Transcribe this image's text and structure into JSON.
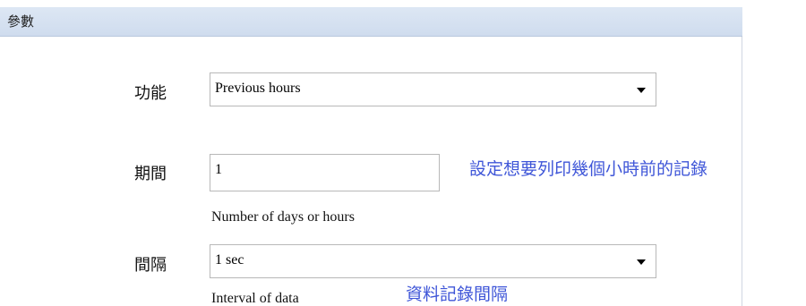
{
  "panel": {
    "title": "參數"
  },
  "fields": {
    "function": {
      "label": "功能",
      "value": "Previous hours"
    },
    "period": {
      "label": "期間",
      "value": "1",
      "help": "Number of days or hours",
      "annotation": "設定想要列印幾個小時前的記錄"
    },
    "interval": {
      "label": "間隔",
      "value": "1 sec",
      "help": "Interval of data",
      "annotation": "資料記錄間隔"
    }
  },
  "colors": {
    "annotation_blue": "#3F56D8",
    "header_blue": "#D7E3F2",
    "field_border": "#B8B8B8"
  },
  "icons": {
    "dropdown": "chevron-down-icon"
  }
}
